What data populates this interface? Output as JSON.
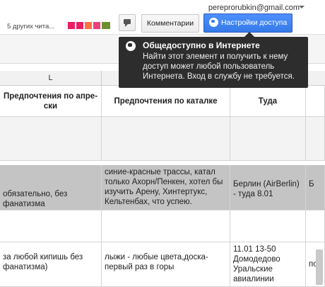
{
  "header": {
    "email": "pereprorubkin@gmail.com",
    "viewers_text": "5 других чита...",
    "viewer_colors": [
      "#e91e63",
      "#e91e63",
      "#ff7043",
      "#ec407a",
      "#8bc34a"
    ],
    "comments_label": "Комментарии",
    "share_label": "Настройки доступа"
  },
  "tooltip": {
    "title": "Общедоступно в Интернете",
    "body": "Найти этот элемент и получить к нему доступ может любой пользователь Интернета. Вход в службу не требуется."
  },
  "grid": {
    "column_letter": "L",
    "headers": [
      "Предпочтения по апре-ски",
      "Предпочтения по каталке",
      "Туда"
    ],
    "rows": [
      [
        "",
        "",
        "",
        ""
      ],
      [
        "обязательно, без фанатизма",
        "синие-красные трассы, катал только Ахорн/Пенкен, хотел бы изучить Арену, Хинтертукс, Кельтенбах, что успею.",
        "Берлин (AirBerlin) - туда 8.01",
        "Б"
      ],
      [
        "",
        "",
        "",
        ""
      ],
      [
        "за любой кипишь без фанатизма)",
        "лыжи - любые цвета,доска-первый раз в горы",
        "11.01 13-50 Домодедово Уральские авиалинии",
        "по"
      ]
    ]
  },
  "colors": {
    "accent": "#4d90fe",
    "tooltip_bg": "#2d2d2d",
    "highlight_row": "#c4c4c4"
  }
}
